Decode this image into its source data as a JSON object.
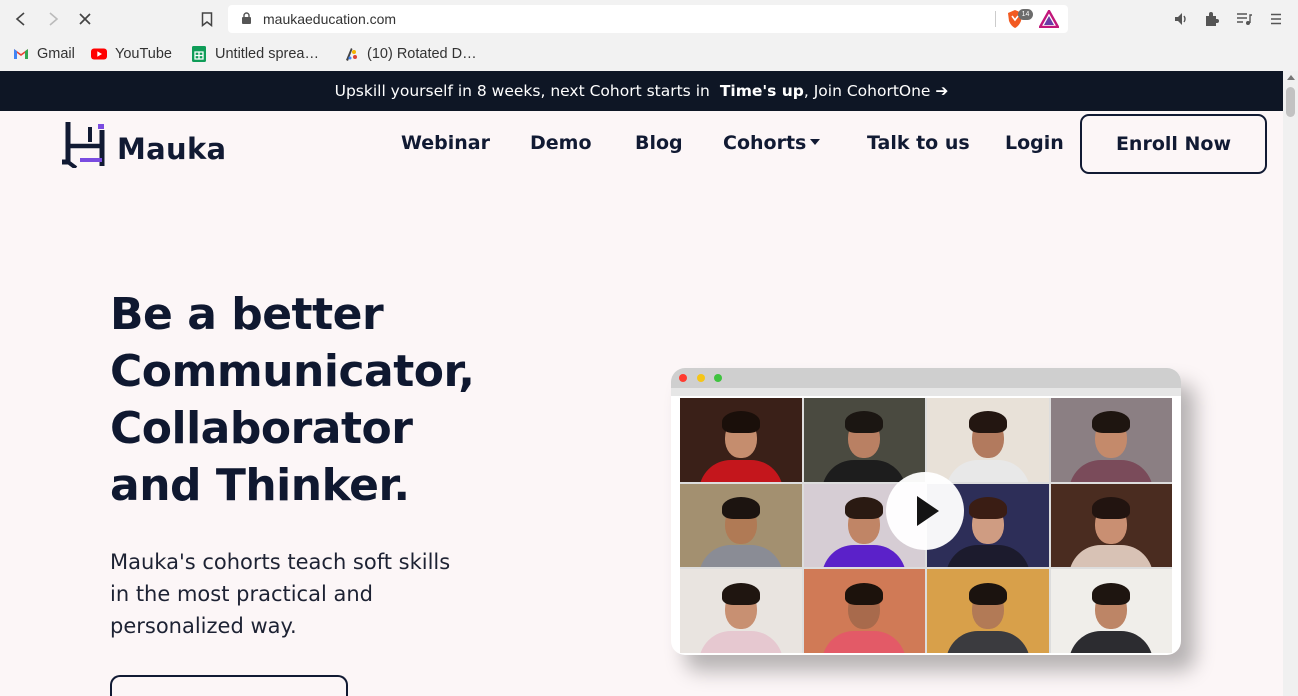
{
  "browser": {
    "url": "maukaeducation.com",
    "shield_count": "14",
    "bookmarks": [
      {
        "label": "Gmail",
        "icon": "gmail-icon"
      },
      {
        "label": "YouTube",
        "icon": "youtube-icon"
      },
      {
        "label": "Untitled sprea…",
        "icon": "google-sheets-icon"
      },
      {
        "label": "(10) Rotated D…",
        "icon": "palette-icon"
      }
    ]
  },
  "announcement": {
    "text": "Upskill yourself in 8 weeks, next Cohort starts in",
    "emphasis": "Time's up",
    "tail": ", Join CohortOne ➔"
  },
  "brand": {
    "name": "Mauka",
    "color": "#111a33"
  },
  "nav": {
    "links": [
      "Webinar",
      "Demo",
      "Blog",
      "Cohorts",
      "Talk to us",
      "Login"
    ],
    "enroll_label": "Enroll Now"
  },
  "hero": {
    "title_lines": [
      "Be a better",
      "Communicator,",
      "Collaborator",
      "and Thinker."
    ],
    "subtitle_lines": [
      "Mauka's cohorts teach soft skills",
      "in the most practical and",
      "personalized way."
    ]
  },
  "colors": {
    "page_bg": "#fcf6f7",
    "announcement_bg": "#0e1625",
    "text_dark": "#111a33"
  }
}
